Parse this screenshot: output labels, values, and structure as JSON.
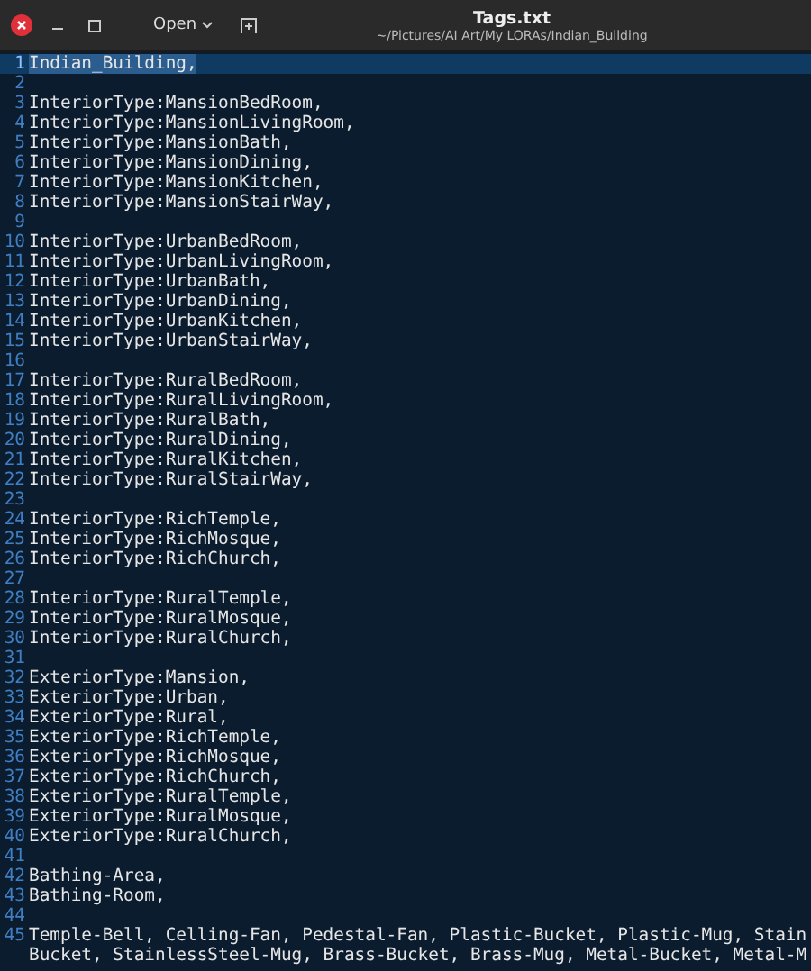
{
  "window": {
    "title": "Tags.txt",
    "subtitle": "~/Pictures/AI Art/My LORAs/Indian_Building"
  },
  "header_buttons": [
    {
      "label": "Open"
    }
  ],
  "lines": [
    {
      "number": "1",
      "text": "Indian_Building,",
      "selected": true
    },
    {
      "number": "2",
      "selected": false
    },
    {
      "number": "3",
      "text": "InteriorType:MansionBedRoom,",
      "selected": false
    },
    {
      "number": "4",
      "text": "InteriorType:MansionLivingRoom,",
      "selected": false
    },
    {
      "number": "5",
      "text": "InteriorType:MansionBath,",
      "selected": false
    },
    {
      "number": "6",
      "text": "InteriorType:MansionDining,",
      "selected": false
    },
    {
      "number": "7",
      "text": "InteriorType:MansionKitchen,",
      "selected": false
    },
    {
      "number": "8",
      "text": "InteriorType:MansionStairWay,",
      "selected": false
    },
    {
      "number": "9",
      "selected": false
    },
    {
      "number": "10",
      "text": "InteriorType:UrbanBedRoom,",
      "selected": false
    },
    {
      "number": "11",
      "text": "InteriorType:UrbanLivingRoom,",
      "selected": false
    },
    {
      "number": "12",
      "text": "InteriorType:UrbanBath,",
      "selected": false
    },
    {
      "number": "13",
      "text": "InteriorType:UrbanDining,",
      "selected": false
    },
    {
      "number": "14",
      "text": "InteriorType:UrbanKitchen,",
      "selected": false
    },
    {
      "number": "15",
      "text": "InteriorType:UrbanStairWay,",
      "selected": false
    },
    {
      "number": "16",
      "selected": false
    },
    {
      "number": "17",
      "text": "InteriorType:RuralBedRoom,",
      "selected": false
    },
    {
      "number": "18",
      "text": "InteriorType:RuralLivingRoom,",
      "selected": false
    },
    {
      "number": "19",
      "text": "InteriorType:RuralBath,",
      "selected": false
    },
    {
      "number": "20",
      "text": "InteriorType:RuralDining,",
      "selected": false
    },
    {
      "number": "21",
      "text": "InteriorType:RuralKitchen,",
      "selected": false
    },
    {
      "number": "22",
      "text": "InteriorType:RuralStairWay,",
      "selected": false
    },
    {
      "number": "23",
      "selected": false
    },
    {
      "number": "24",
      "text": "InteriorType:RichTemple,",
      "selected": false
    },
    {
      "number": "25",
      "text": "InteriorType:RichMosque,",
      "selected": false
    },
    {
      "number": "26",
      "text": "InteriorType:RichChurch,",
      "selected": false
    },
    {
      "number": "27",
      "selected": false
    },
    {
      "number": "28",
      "text": "InteriorType:RuralTemple,",
      "selected": false
    },
    {
      "number": "29",
      "text": "InteriorType:RuralMosque,",
      "selected": false
    },
    {
      "number": "30",
      "text": "InteriorType:RuralChurch,",
      "selected": false
    },
    {
      "number": "31",
      "selected": false
    },
    {
      "number": "32",
      "text": "ExteriorType:Mansion,",
      "selected": false
    },
    {
      "number": "33",
      "text": "ExteriorType:Urban,",
      "selected": false
    },
    {
      "number": "34",
      "text": "ExteriorType:Rural,",
      "selected": false
    },
    {
      "number": "35",
      "text": "ExteriorType:RichTemple,",
      "selected": false
    },
    {
      "number": "36",
      "text": "ExteriorType:RichMosque,",
      "selected": false
    },
    {
      "number": "37",
      "text": "ExteriorType:RichChurch,",
      "selected": false
    },
    {
      "number": "38",
      "text": "ExteriorType:RuralTemple,",
      "selected": false
    },
    {
      "number": "39",
      "text": "ExteriorType:RuralMosque,",
      "selected": false
    },
    {
      "number": "40",
      "text": "ExteriorType:RuralChurch,",
      "selected": false
    },
    {
      "number": "41",
      "selected": false
    },
    {
      "number": "42",
      "text": "Bathing-Area,",
      "selected": false
    },
    {
      "number": "43",
      "text": "Bathing-Room,",
      "selected": false
    },
    {
      "number": "44",
      "selected": false
    },
    {
      "number": "45",
      "text": "Temple-Bell, Celling-Fan, Pedestal-Fan, Plastic-Bucket, Plastic-Mug, Stain",
      "continuation": "Bucket, StainlessSteel-Mug, Brass-Bucket, Brass-Mug, Metal-Bucket, Metal-M",
      "selected": false
    }
  ]
}
